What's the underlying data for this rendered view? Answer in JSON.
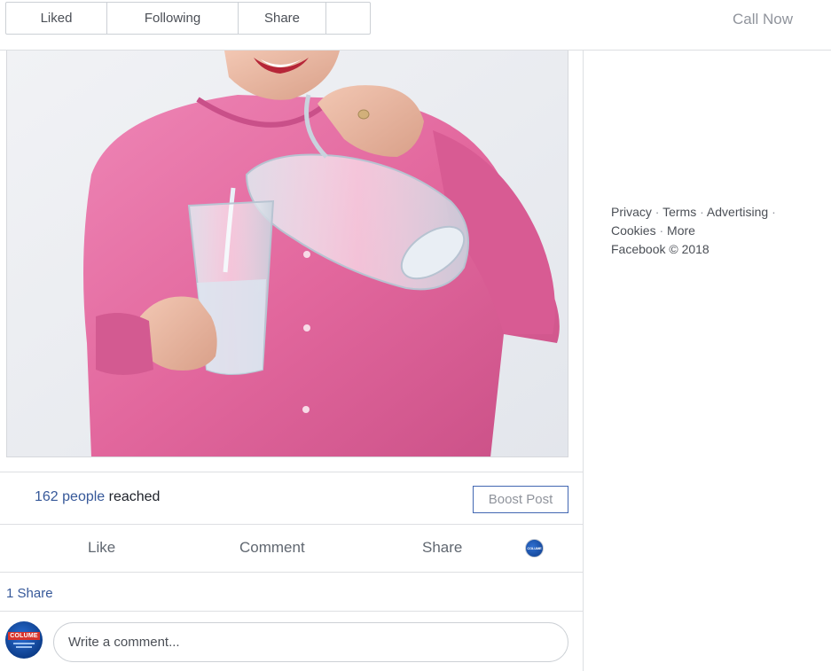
{
  "page_header": {
    "liked_label": "Liked",
    "following_label": "Following",
    "share_label": "Share",
    "more_label": "",
    "call_now_label": "Call Now"
  },
  "post": {
    "reach": {
      "count_link": "162 people",
      "suffix": " reached",
      "boost_label": "Boost Post"
    },
    "actions": {
      "like_label": "Like",
      "comment_label": "Comment",
      "share_label": "Share"
    },
    "shares_count_label": "1 Share",
    "comment_box": {
      "placeholder": "Write a comment..."
    },
    "avatar_logo_text": "COLUME"
  },
  "footer": {
    "links": [
      "Privacy",
      "Terms",
      "Advertising",
      "Cookies",
      "More"
    ],
    "copyright": "Facebook © 2018"
  },
  "colors": {
    "link_blue": "#365899",
    "border": "#dddfe2",
    "muted_text": "#90949c",
    "boost_border": "#4267b2",
    "shirt_pink": "#e2679d"
  }
}
